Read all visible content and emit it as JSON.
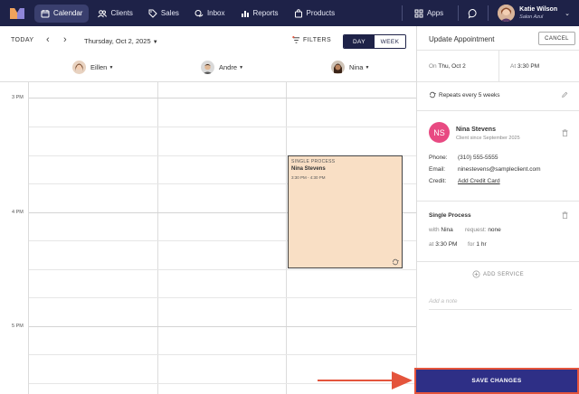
{
  "nav": {
    "items": [
      {
        "label": "Calendar",
        "icon": "calendar-icon",
        "active": true
      },
      {
        "label": "Clients",
        "icon": "people-icon"
      },
      {
        "label": "Sales",
        "icon": "tag-icon"
      },
      {
        "label": "Inbox",
        "icon": "chat-bubble-icon"
      },
      {
        "label": "Reports",
        "icon": "bar-chart-icon"
      },
      {
        "label": "Products",
        "icon": "bag-icon"
      }
    ],
    "apps_label": "Apps",
    "user_name": "Katie Wilson",
    "user_location": "Salon Azul"
  },
  "calendar": {
    "today_label": "TODAY",
    "date_label": "Thursday, Oct 2, 2025",
    "filters_label": "FILTERS",
    "view_day": "DAY",
    "view_week": "WEEK",
    "staff": [
      "Eillen",
      "Andre",
      "Nina"
    ],
    "time_labels": [
      "3 PM",
      "4 PM",
      "5 PM"
    ]
  },
  "appointment_block": {
    "service": "SINGLE PROCESS",
    "client": "Nina Stevens",
    "time": "3:30 PM - 4:30 PM"
  },
  "panel": {
    "title": "Update Appointment",
    "cancel_label": "CANCEL",
    "date_prefix": "On",
    "date_value": "Thu, Oct 2",
    "time_prefix": "At",
    "time_value": "3:30 PM",
    "repeat_text": "Repeats every 5 weeks",
    "client_initials": "NS",
    "client_name": "Nina Stevens",
    "client_since": "Client since September 2025",
    "phone_label": "Phone:",
    "phone_value": "(310) 555-5555",
    "email_label": "Email:",
    "email_value": "ninestevens@sampleclient.com",
    "credit_label": "Credit:",
    "credit_link": "Add Credit Card",
    "service_name": "Single Process",
    "with_label": "with",
    "with_value": "Nina",
    "request_label": "request:",
    "request_value": "none",
    "at_label": "at",
    "at_value": "3:30 PM",
    "for_label": "for",
    "for_value": "1 hr",
    "add_service_label": "ADD SERVICE",
    "note_placeholder": "Add a note",
    "save_label": "SAVE CHANGES"
  },
  "colors": {
    "nav_bg": "#1e2248",
    "appointment_fill": "#f9dfc5",
    "client_avatar": "#e84a82",
    "save_button": "#2e2f86",
    "highlight": "#e4543c"
  }
}
